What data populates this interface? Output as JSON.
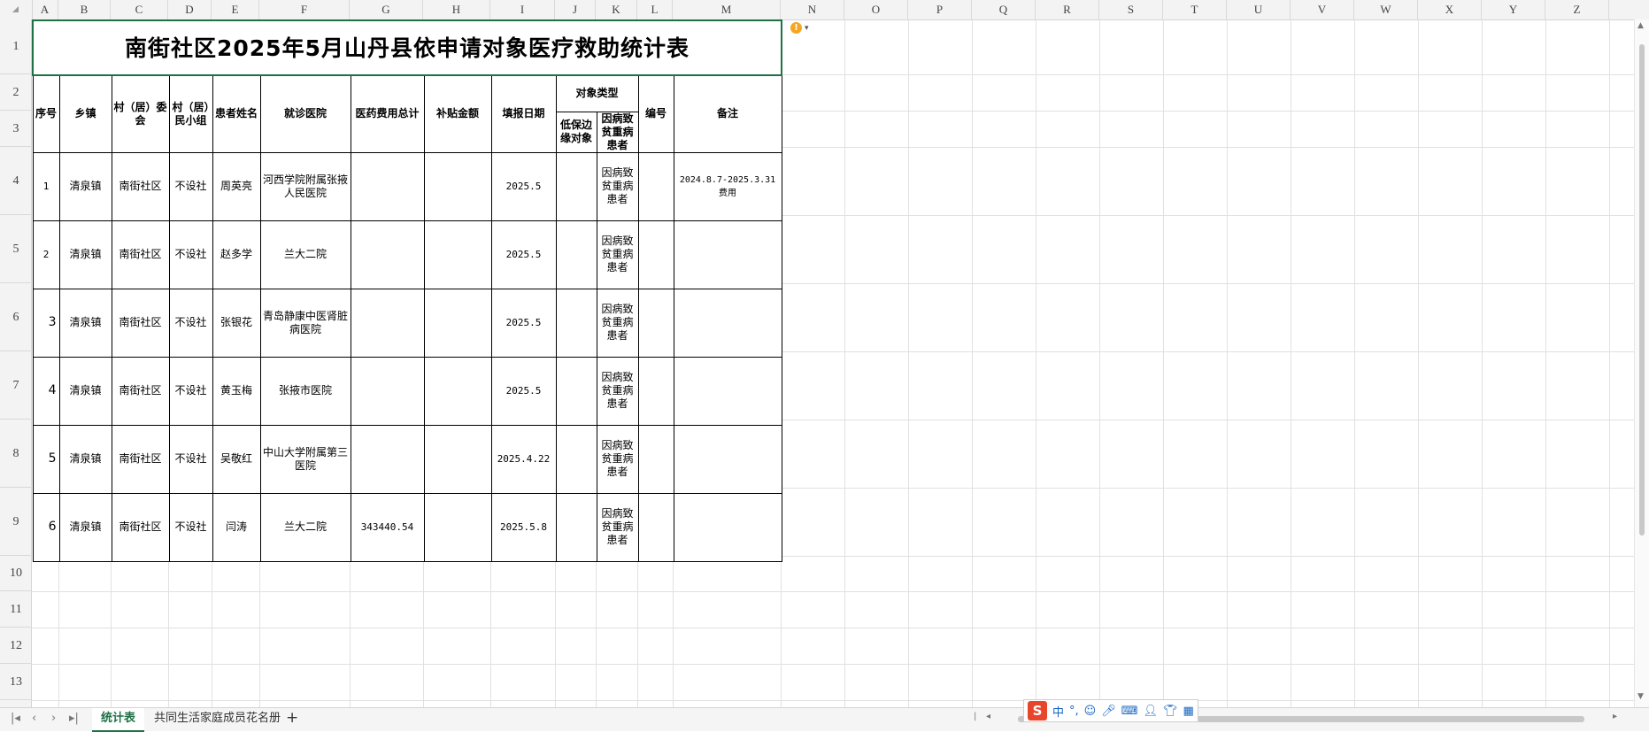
{
  "columns": [
    "A",
    "B",
    "C",
    "D",
    "E",
    "F",
    "G",
    "H",
    "I",
    "J",
    "K",
    "L",
    "M",
    "N",
    "O",
    "P",
    "Q",
    "R",
    "S",
    "T",
    "U",
    "V",
    "W",
    "X",
    "Y",
    "Z"
  ],
  "rows": [
    "1",
    "2",
    "3",
    "4",
    "5",
    "6",
    "7",
    "8",
    "9",
    "10",
    "11",
    "12",
    "13"
  ],
  "title": "南街社区2025年5月山丹县依申请对象医疗救助统计表",
  "headers": {
    "seq": "序号",
    "town": "乡镇",
    "village": "村（居）委会",
    "group": "村（居）民小组",
    "patient": "患者姓名",
    "hospital": "就诊医院",
    "total": "医药费用总计",
    "subsidy": "补贴金额",
    "date": "填报日期",
    "type": "对象类型",
    "type_low": "低保边缘对象",
    "type_ill": "因病致贫重病患者",
    "code": "编号",
    "remark": "备注"
  },
  "records": [
    {
      "seq": "1",
      "town": "清泉镇",
      "village": "南街社区",
      "group": "不设社",
      "patient": "周英亮",
      "hospital": "河西学院附属张掖人民医院",
      "total": "",
      "subsidy": "",
      "date": "2025.5",
      "low": "",
      "ill": "因病致贫重病患者",
      "code": "",
      "remark": "2024.8.7-2025.3.31费用"
    },
    {
      "seq": "2",
      "town": "清泉镇",
      "village": "南街社区",
      "group": "不设社",
      "patient": "赵多学",
      "hospital": "兰大二院",
      "total": "",
      "subsidy": "",
      "date": "2025.5",
      "low": "",
      "ill": "因病致贫重病患者",
      "code": "",
      "remark": ""
    },
    {
      "seq": "3",
      "town": "清泉镇",
      "village": "南街社区",
      "group": "不设社",
      "patient": "张银花",
      "hospital": "青岛静康中医肾脏病医院",
      "total": "",
      "subsidy": "",
      "date": "2025.5",
      "low": "",
      "ill": "因病致贫重病患者",
      "code": "",
      "remark": ""
    },
    {
      "seq": "4",
      "town": "清泉镇",
      "village": "南街社区",
      "group": "不设社",
      "patient": "黄玉梅",
      "hospital": "张掖市医院",
      "total": "",
      "subsidy": "",
      "date": "2025.5",
      "low": "",
      "ill": "因病致贫重病患者",
      "code": "",
      "remark": ""
    },
    {
      "seq": "5",
      "town": "清泉镇",
      "village": "南街社区",
      "group": "不设社",
      "patient": "吴敬红",
      "hospital": "中山大学附属第三医院",
      "total": "",
      "subsidy": "",
      "date": "2025.4.22",
      "low": "",
      "ill": "因病致贫重病患者",
      "code": "",
      "remark": ""
    },
    {
      "seq": "6",
      "town": "清泉镇",
      "village": "南街社区",
      "group": "不设社",
      "patient": "闫涛",
      "hospital": "兰大二院",
      "total": "343440.54",
      "subsidy": "",
      "date": "2025.5.8",
      "low": "",
      "ill": "因病致贫重病患者",
      "code": "",
      "remark": ""
    }
  ],
  "sheets": {
    "active": "统计表",
    "other": "共同生活家庭成员花名册",
    "add": "+"
  },
  "ime": {
    "logo": "S",
    "lang": "中",
    "punct": "°,"
  }
}
